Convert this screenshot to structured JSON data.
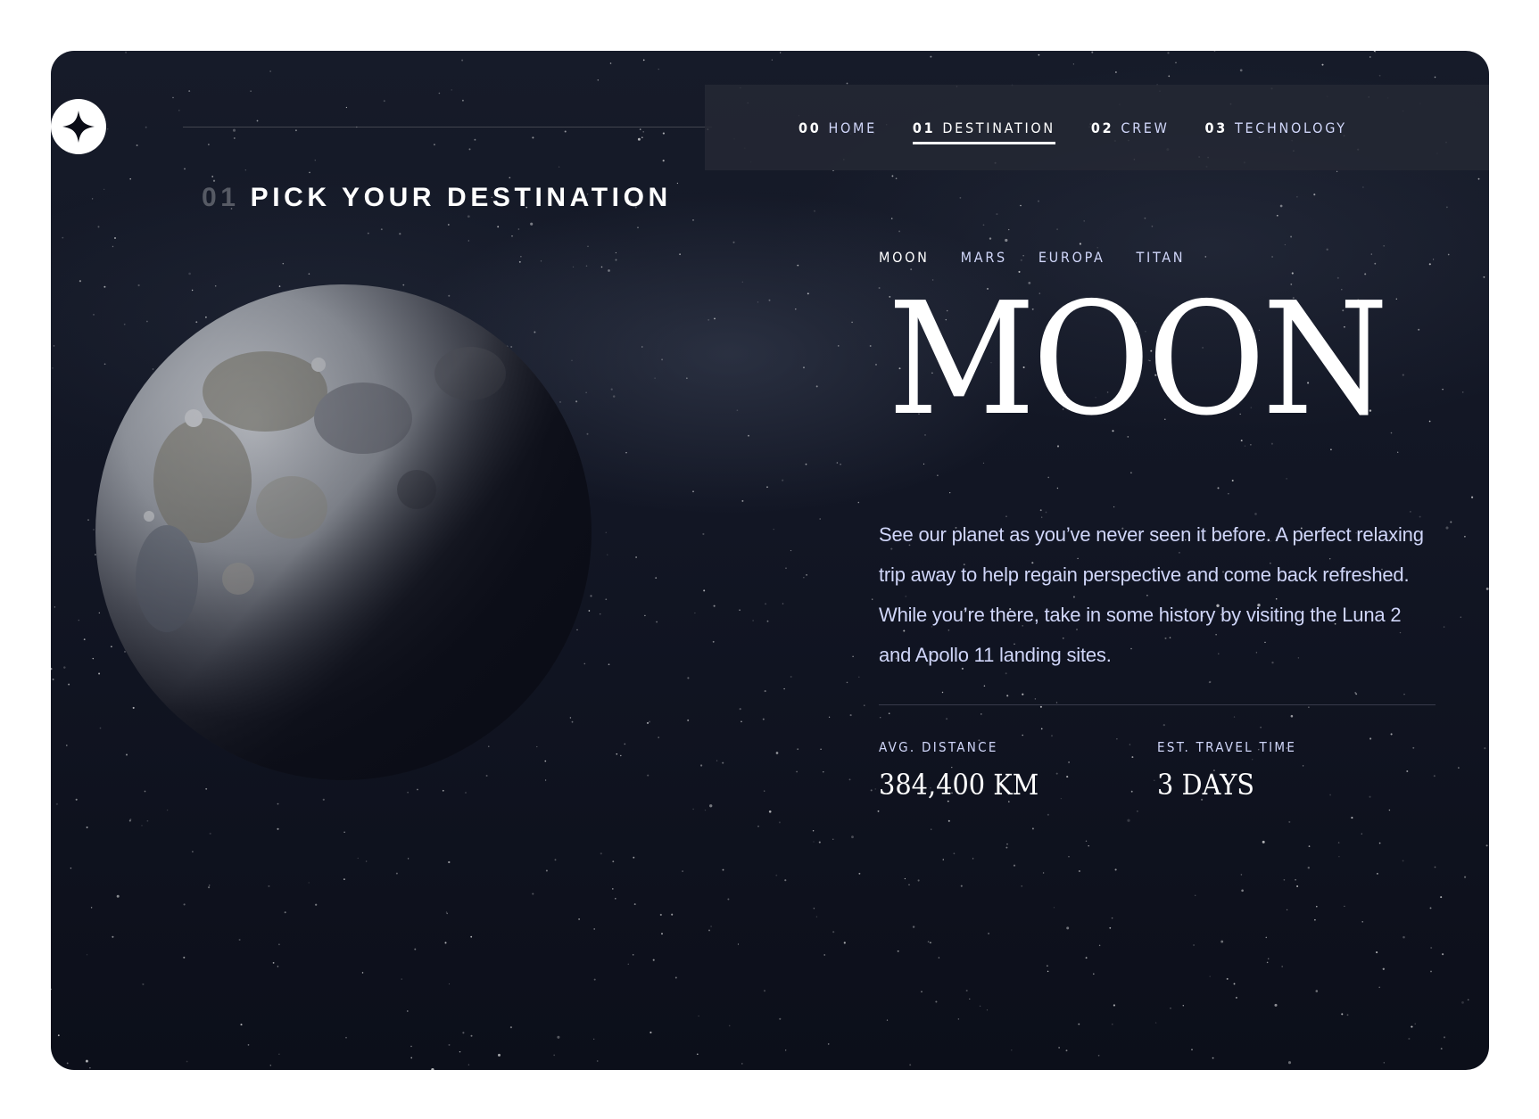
{
  "nav": {
    "items": [
      {
        "num": "00",
        "label": "HOME",
        "active": false
      },
      {
        "num": "01",
        "label": "DESTINATION",
        "active": true
      },
      {
        "num": "02",
        "label": "CREW",
        "active": false
      },
      {
        "num": "03",
        "label": "TECHNOLOGY",
        "active": false
      }
    ]
  },
  "heading": {
    "num": "01",
    "text": "PICK YOUR DESTINATION"
  },
  "tabs": [
    {
      "label": "MOON",
      "active": true
    },
    {
      "label": "MARS",
      "active": false
    },
    {
      "label": "EUROPA",
      "active": false
    },
    {
      "label": "TITAN",
      "active": false
    }
  ],
  "destination": {
    "name": "MOON",
    "description": "See our planet as you’ve never seen it before. A perfect relaxing trip away to help regain perspective and come back refreshed. While you’re there, take in some history by visiting the Luna 2 and Apollo 11 landing sites.",
    "distance_label": "AVG. DISTANCE",
    "distance_value": "384,400 KM",
    "travel_label": "EST. TRAVEL TIME",
    "travel_value": "3 DAYS"
  },
  "colors": {
    "background": "#0b0d17",
    "accent": "#d0d6f9",
    "white": "#ffffff"
  },
  "icons": {
    "logo": "four-point-star-icon"
  }
}
